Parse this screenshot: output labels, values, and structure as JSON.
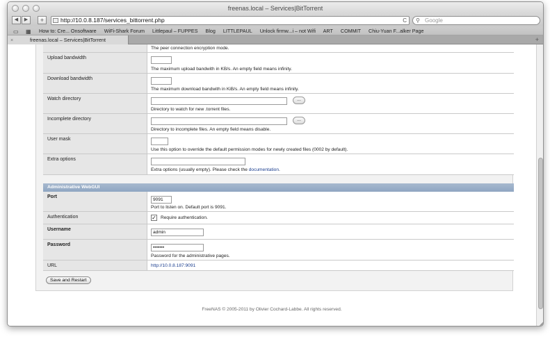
{
  "window": {
    "title": "freenas.local – Services|BitTorrent"
  },
  "toolbar": {
    "back": "◀",
    "forward": "▶",
    "add": "+",
    "url": "http://10.0.8.187/services_bittorrent.php",
    "reload": "C",
    "search_placeholder": "Google"
  },
  "bookmarks": [
    "How to: Cre... Onsoftware",
    "WiFi-Shark Forum",
    "Littlepaul – FUPPES",
    "Blog",
    "LITTLEPAUL",
    "Unlock firmw...i – not Wifi",
    "ART",
    "COMMIT",
    "Chiu-Yuan F...alker Page"
  ],
  "tab": {
    "label": "freenas.local – Services|BitTorrent"
  },
  "form": {
    "encryption_desc": "The peer connection encryption mode.",
    "upload_label": "Upload bandwidth",
    "upload_value": "",
    "upload_desc": "The maximum upload bandwith in KB/s. An empty field means infinity.",
    "download_label": "Download bandwidth",
    "download_value": "",
    "download_desc": "The maximum download bandwith in KiB/s. An empty field means infinity.",
    "watch_label": "Watch directory",
    "watch_value": "",
    "watch_desc": "Directory to watch for new .torrent files.",
    "watch_browse": "...",
    "incomplete_label": "Incomplete directory",
    "incomplete_value": "",
    "incomplete_desc": "Directory to incomplete files. An empty field means disable.",
    "incomplete_browse": "...",
    "umask_label": "User mask",
    "umask_value": "",
    "umask_desc": "Use this option to override the default permission modes for newly created files (0002 by default).",
    "extra_label": "Extra options",
    "extra_value": "",
    "extra_desc_prefix": "Extra options (usually empty). Please check the ",
    "extra_desc_link": "documentation",
    "extra_desc_suffix": "."
  },
  "webgui": {
    "header": "Administrative WebGUI",
    "port_label": "Port",
    "port_value": "9091",
    "port_desc": "Port to listen on. Default port is 9091.",
    "auth_label": "Authentication",
    "auth_checked": true,
    "auth_desc": "Require authentication.",
    "username_label": "Username",
    "username_value": "admin",
    "password_label": "Password",
    "password_value": "•••••••",
    "password_desc": "Password for the administrative pages.",
    "url_label": "URL",
    "url_value": "http://10.0.8.187:9091"
  },
  "actions": {
    "save_label": "Save and Restart"
  },
  "footer": {
    "text": "FreeNAS © 2005-2011 by Olivier Cochard-Labbe. All rights reserved."
  }
}
